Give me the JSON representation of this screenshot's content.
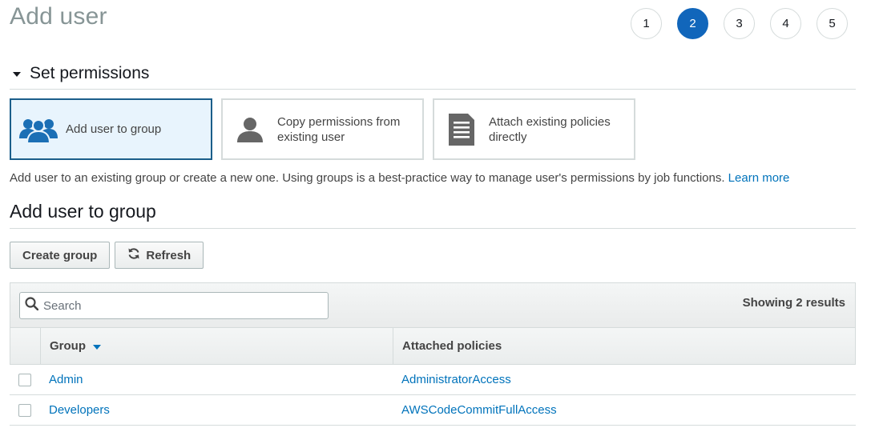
{
  "header": {
    "title": "Add user"
  },
  "steps": [
    {
      "label": "1",
      "active": false
    },
    {
      "label": "2",
      "active": true
    },
    {
      "label": "3",
      "active": false
    },
    {
      "label": "4",
      "active": false
    },
    {
      "label": "5",
      "active": false
    }
  ],
  "permissions": {
    "title": "Set permissions",
    "options": [
      {
        "label": "Add user to group",
        "icon": "users-group-icon",
        "selected": true
      },
      {
        "label": "Copy permissions from existing user",
        "icon": "user-icon",
        "selected": false
      },
      {
        "label": "Attach existing policies directly",
        "icon": "document-icon",
        "selected": false
      }
    ],
    "description": "Add user to an existing group or create a new one. Using groups is a best-practice way to manage user's permissions by job functions.",
    "learn_more": "Learn more"
  },
  "group_section": {
    "title": "Add user to group",
    "create_button": "Create group",
    "refresh_button": "Refresh"
  },
  "table": {
    "search_placeholder": "Search",
    "results_text": "Showing 2 results",
    "columns": {
      "group": "Group",
      "policies": "Attached policies"
    },
    "rows": [
      {
        "group": "Admin",
        "policies": "AdministratorAccess"
      },
      {
        "group": "Developers",
        "policies": "AWSCodeCommitFullAccess"
      }
    ]
  },
  "colors": {
    "accent": "#1166bb",
    "link": "#0073bb",
    "selected_border": "#1b5e8a",
    "selected_bg": "#e8f4fd",
    "icon_blue": "#1b6fb5",
    "icon_gray": "#666666"
  }
}
